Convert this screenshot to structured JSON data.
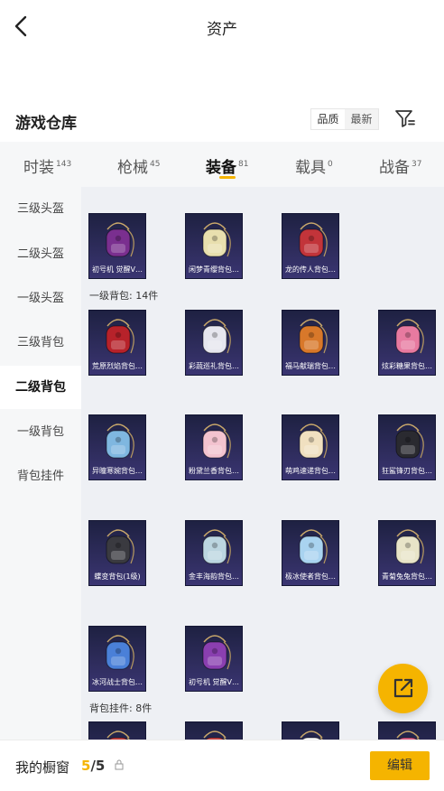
{
  "header": {
    "title": "资产"
  },
  "section": {
    "title": "游戏仓库",
    "sort_quality": "品质",
    "sort_newest": "最新"
  },
  "tabs": [
    {
      "label": "时装",
      "count": "143"
    },
    {
      "label": "枪械",
      "count": "45"
    },
    {
      "label": "装备",
      "count": "81"
    },
    {
      "label": "载具",
      "count": "0"
    },
    {
      "label": "战备",
      "count": "37"
    }
  ],
  "sidebar": [
    "三级头盔",
    "二级头盔",
    "一级头盔",
    "三级背包",
    "二级背包",
    "一级背包",
    "背包挂件"
  ],
  "groups": {
    "level1_bag": "一级背包: 14件",
    "pendant": "背包挂件: 8件"
  },
  "items": [
    {
      "name": "初号机 觉醒V…",
      "icon": "purple-mech-backpack-icon",
      "color": "#7a2f8f"
    },
    {
      "name": "闲梦青缨背包…",
      "icon": "cream-round-backpack-icon",
      "color": "#e8dfae"
    },
    {
      "name": "龙的传人背包…",
      "icon": "red-dragon-backpack-icon",
      "color": "#c2343a"
    },
    {
      "name": "荒原烈焰背包…",
      "icon": "flame-mask-backpack-icon",
      "color": "#b7222a"
    },
    {
      "name": "彩蔬巡礼背包…",
      "icon": "white-rabbit-backpack-icon",
      "color": "#e6e6ee"
    },
    {
      "name": "福马献瑞背包…",
      "icon": "orange-horse-backpack-icon",
      "color": "#d8782a"
    },
    {
      "name": "炫彩糖果背包…",
      "icon": "donut-backpack-icon",
      "color": "#e77aa0"
    },
    {
      "name": "异瞳寒婉背包…",
      "icon": "blue-mascot-backpack-icon",
      "color": "#7fb7e0"
    },
    {
      "name": "粉黛兰香背包…",
      "icon": "pink-bunny-backpack-icon",
      "color": "#f3c3cf"
    },
    {
      "name": "萌鸡速递背包…",
      "icon": "chick-backpack-icon",
      "color": "#f0e0c0"
    },
    {
      "name": "狂鲨锋刃背包…",
      "icon": "black-shark-backpack-icon",
      "color": "#2a2a30"
    },
    {
      "name": "蝶变背包(1级)",
      "icon": "black-butterfly-backpack-icon",
      "color": "#3a3a40"
    },
    {
      "name": "金丰海韵背包…",
      "icon": "shell-backpack-icon",
      "color": "#bcd6e0"
    },
    {
      "name": "极冰使者背包…",
      "icon": "ice-backpack-icon",
      "color": "#a9d3f0"
    },
    {
      "name": "青菊兔兔背包…",
      "icon": "bunny-bag-backpack-icon",
      "color": "#e8e4c8"
    },
    {
      "name": "冰河战士背包…",
      "icon": "blue-armor-backpack-icon",
      "color": "#4a80d8"
    },
    {
      "name": "初号机 觉醒V…",
      "icon": "purple-mech-backpack-icon",
      "color": "#8a3fb0"
    },
    {
      "name": "",
      "icon": "pendant-icon",
      "color": "#c84040"
    },
    {
      "name": "",
      "icon": "pendant-icon",
      "color": "#d04848"
    },
    {
      "name": "",
      "icon": "pendant-icon",
      "color": "#ffffff"
    },
    {
      "name": "",
      "icon": "pendant-icon",
      "color": "#e0608a"
    }
  ],
  "bottom": {
    "showcase_label": "我的橱窗",
    "showcase_current": "5",
    "showcase_total": "/5",
    "edit_label": "编辑"
  }
}
